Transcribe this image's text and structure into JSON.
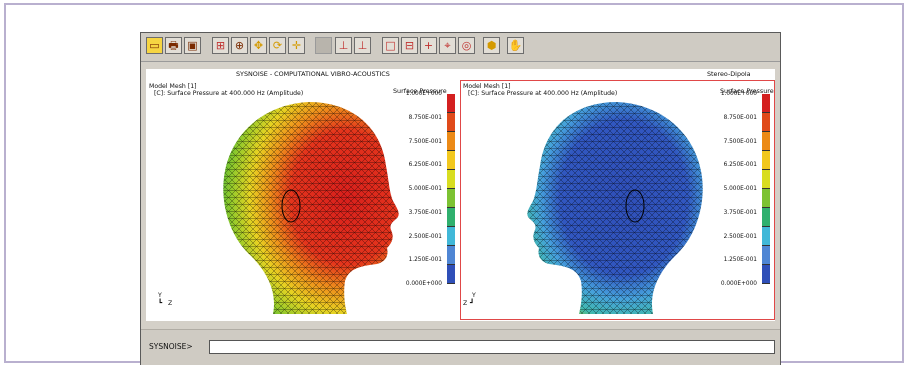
{
  "app": {
    "header_title": "SYSNOISE - COMPUTATIONAL VIBRO-ACOUSTICS",
    "header_right": "Stereo-Dipola"
  },
  "toolbar": {
    "buttons": [
      {
        "name": "select-icon",
        "glyph": "▭"
      },
      {
        "name": "print-icon",
        "glyph": "🖶"
      },
      {
        "name": "copy-icon",
        "glyph": "▣"
      },
      {
        "name": "zoom-region-icon",
        "glyph": "⊞"
      },
      {
        "name": "zoom-icon",
        "glyph": "⊕"
      },
      {
        "name": "pan-icon",
        "glyph": "✥"
      },
      {
        "name": "rotate-icon",
        "glyph": "⟳"
      },
      {
        "name": "center-icon",
        "glyph": "✛"
      },
      {
        "name": "separator-icon",
        "glyph": ""
      },
      {
        "name": "axis-icon",
        "glyph": "⊥"
      },
      {
        "name": "axis-alt-icon",
        "glyph": "⊥"
      },
      {
        "name": "frame-icon",
        "glyph": "□"
      },
      {
        "name": "grid-icon",
        "glyph": "⊟"
      },
      {
        "name": "plus-icon",
        "glyph": "+"
      },
      {
        "name": "cursor-icon",
        "glyph": "⌖"
      },
      {
        "name": "nodes-icon",
        "glyph": "◎"
      },
      {
        "name": "render-icon",
        "glyph": "⬢"
      },
      {
        "name": "hand-icon",
        "glyph": "✋"
      }
    ]
  },
  "panels": [
    {
      "model": "Model Mesh [1]",
      "result": "[C]: Surface Pressure at 400.000 Hz (Amplitude)",
      "legend_title": "Surface Pressure",
      "axis_v": "Y",
      "axis_h": "Z"
    },
    {
      "model": "Model Mesh [1]",
      "result": "[C]: Surface Pressure at 400.000 Hz (Amplitude)",
      "legend_title": "Surface Pressure",
      "axis_v": "Y",
      "axis_h": "Z"
    }
  ],
  "legend": {
    "ticks": [
      "1.000E+000",
      "8.750E-001",
      "7.500E-001",
      "6.250E-001",
      "5.000E-001",
      "3.750E-001",
      "2.500E-001",
      "1.250E-001",
      "0.000E+000"
    ],
    "colors": [
      "#d42020",
      "#e04a1a",
      "#ec8a16",
      "#f2c81e",
      "#d8dd20",
      "#7cc232",
      "#2fb06e",
      "#41b8d8",
      "#4f86d4",
      "#2f4fb8"
    ]
  },
  "command": {
    "prompt": "SYSNOISE>",
    "value": ""
  }
}
